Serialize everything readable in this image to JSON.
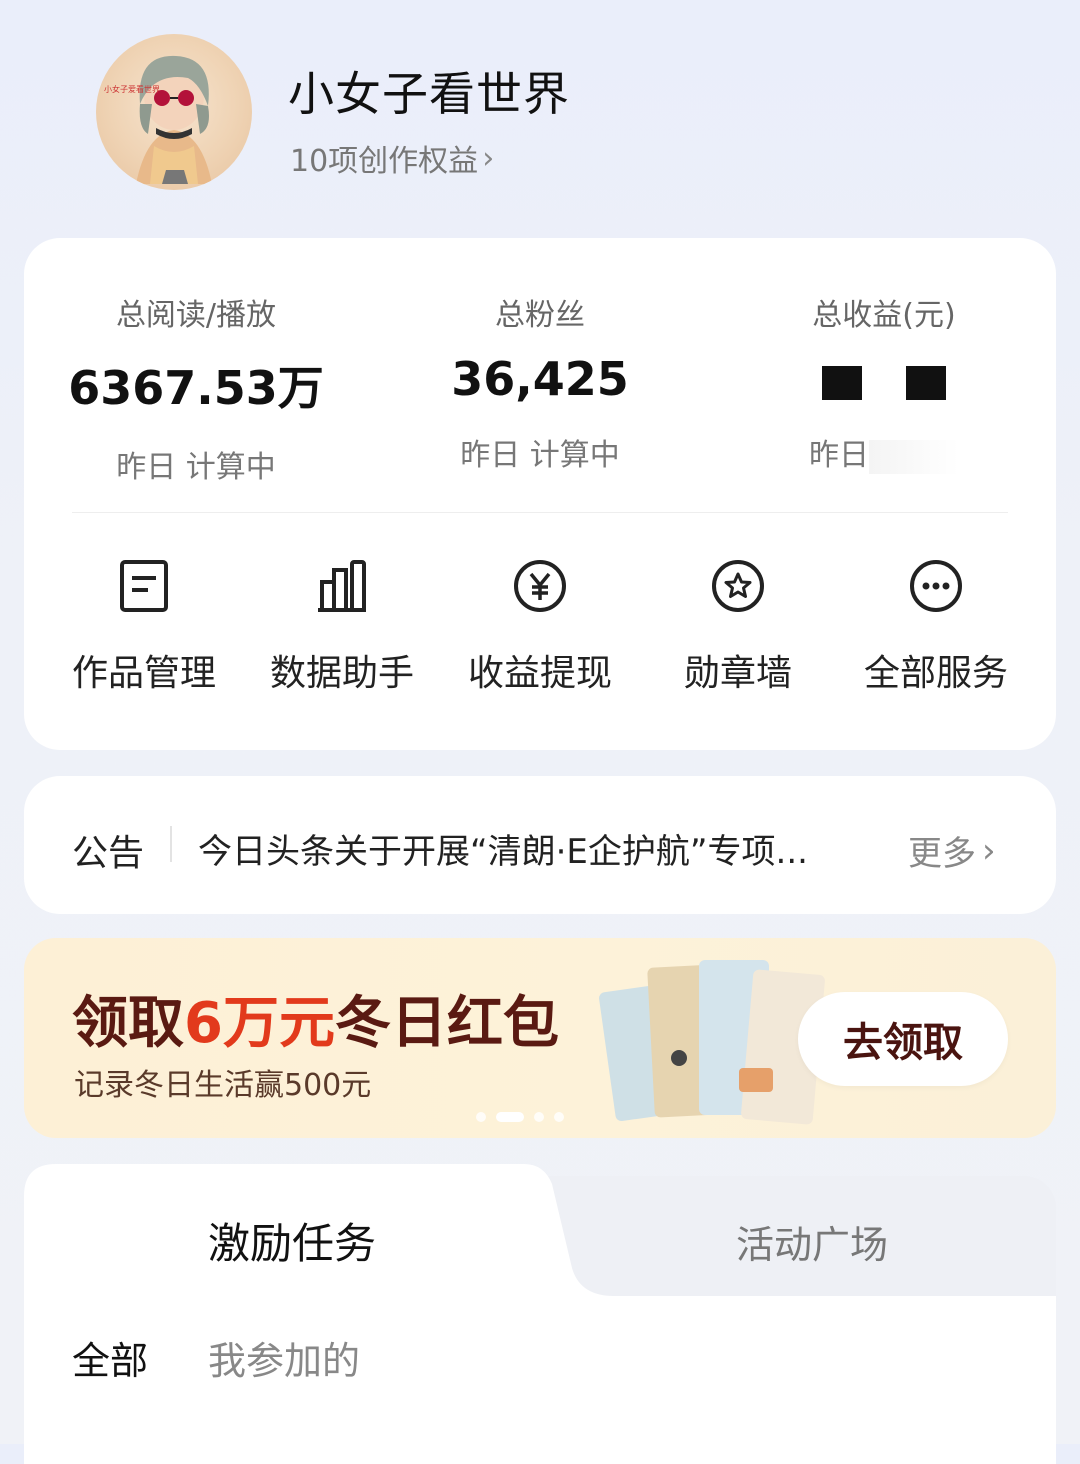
{
  "profile": {
    "avatar_caption": "小女子爱看世界",
    "username": "小女子看世界",
    "rights_link": "10项创作权益"
  },
  "stats": [
    {
      "label": "总阅读/播放",
      "value": "6367.53万",
      "sub": "昨日 计算中"
    },
    {
      "label": "总粉丝",
      "value": "36,425",
      "sub": "昨日 计算中"
    },
    {
      "label": "总收益(元)",
      "value": "",
      "sub": "昨日"
    }
  ],
  "services": [
    {
      "label": "作品管理",
      "icon": "document-icon"
    },
    {
      "label": "数据助手",
      "icon": "bar-chart-icon"
    },
    {
      "label": "收益提现",
      "icon": "yen-circle-icon"
    },
    {
      "label": "勋章墙",
      "icon": "medal-icon"
    },
    {
      "label": "全部服务",
      "icon": "more-circle-icon"
    }
  ],
  "notice": {
    "title": "公告",
    "text": "今日头条关于开展“清朗·E企护航”专项...",
    "more": "更多"
  },
  "banner": {
    "title_pre": "领取",
    "title_highlight": "6万元",
    "title_post": "冬日红包",
    "subtitle": "记录冬日生活赢500元",
    "button": "去领取",
    "page_count": 4,
    "active_page": 2
  },
  "tabs": {
    "active": "激励任务",
    "inactive": "活动广场"
  },
  "filters": {
    "all": "全部",
    "mine": "我参加的"
  },
  "colors": {
    "accent_red": "#e23a1c",
    "banner_dark": "#5a1a12"
  }
}
